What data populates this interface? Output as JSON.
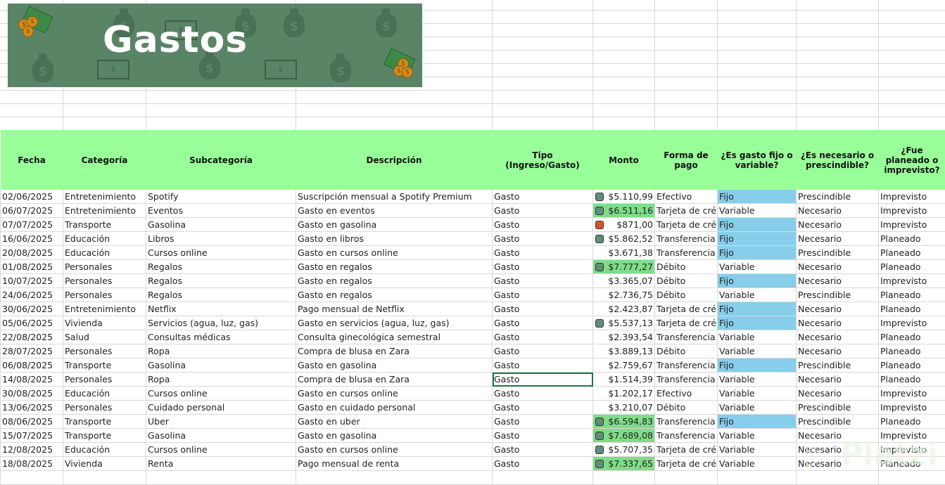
{
  "banner": {
    "title": "Gastos"
  },
  "colors": {
    "header_bg": "#99ff99",
    "highlight_green": "#7fdd88",
    "fijo_blue": "#87ceeb",
    "indicator_gray": "#5f8f7a",
    "indicator_red": "#d9532c",
    "banner_bg": "#5a8466"
  },
  "headers": [
    "Fecha",
    "Categoría",
    "Subcategoría",
    "Descripción",
    "Tipo (Ingreso/Gasto)",
    "Monto",
    "Forma de pago",
    "¿Es gasto fijo o variable?",
    "¿Es necesario o prescindible?",
    "¿Fue planeado o imprevisto?"
  ],
  "rows": [
    {
      "fecha": "02/06/2025",
      "cat": "Entretenimiento",
      "sub": "Spotify",
      "desc": "Suscripción mensual a Spotify Premium",
      "tipo": "Gasto",
      "monto": "$5.110,99",
      "icon": "gray",
      "hi": false,
      "pago": "Efectivo",
      "fv": "Fijo",
      "np": "Prescindible",
      "pi": "Imprevisto"
    },
    {
      "fecha": "06/07/2025",
      "cat": "Entretenimiento",
      "sub": "Eventos",
      "desc": "Gasto en eventos",
      "tipo": "Gasto",
      "monto": "$6.511,16",
      "icon": "gray",
      "hi": true,
      "pago": "Tarjeta de cré",
      "fv": "Variable",
      "np": "Necesario",
      "pi": "Imprevisto"
    },
    {
      "fecha": "07/07/2025",
      "cat": "Transporte",
      "sub": "Gasolina",
      "desc": "Gasto en gasolina",
      "tipo": "Gasto",
      "monto": "$871,00",
      "icon": "red",
      "hi": false,
      "pago": "Tarjeta de cré",
      "fv": "Fijo",
      "np": "Necesario",
      "pi": "Imprevisto"
    },
    {
      "fecha": "16/06/2025",
      "cat": "Educación",
      "sub": "Libros",
      "desc": "Gasto en libros",
      "tipo": "Gasto",
      "monto": "$5.862,52",
      "icon": "gray",
      "hi": false,
      "pago": "Transferencia",
      "fv": "Fijo",
      "np": "Necesario",
      "pi": "Planeado"
    },
    {
      "fecha": "20/08/2025",
      "cat": "Educación",
      "sub": "Cursos online",
      "desc": "Gasto en cursos online",
      "tipo": "Gasto",
      "monto": "$3.671,38",
      "icon": "",
      "hi": false,
      "pago": "Transferencia",
      "fv": "Fijo",
      "np": "Prescindible",
      "pi": "Planeado"
    },
    {
      "fecha": "01/08/2025",
      "cat": "Personales",
      "sub": "Regalos",
      "desc": "Gasto en regalos",
      "tipo": "Gasto",
      "monto": "$7.777,27",
      "icon": "gray",
      "hi": true,
      "pago": "Débito",
      "fv": "Variable",
      "np": "Necesario",
      "pi": "Planeado"
    },
    {
      "fecha": "10/07/2025",
      "cat": "Personales",
      "sub": "Regalos",
      "desc": "Gasto en regalos",
      "tipo": "Gasto",
      "monto": "$3.365,07",
      "icon": "",
      "hi": false,
      "pago": "Débito",
      "fv": "Fijo",
      "np": "Necesario",
      "pi": "Imprevisto"
    },
    {
      "fecha": "24/06/2025",
      "cat": "Personales",
      "sub": "Regalos",
      "desc": "Gasto en regalos",
      "tipo": "Gasto",
      "monto": "$2.736,75",
      "icon": "",
      "hi": false,
      "pago": "Débito",
      "fv": "Variable",
      "np": "Prescindible",
      "pi": "Planeado"
    },
    {
      "fecha": "30/06/2025",
      "cat": "Entretenimiento",
      "sub": "Netflix",
      "desc": "Pago mensual de Netflix",
      "tipo": "Gasto",
      "monto": "$2.423,87",
      "icon": "",
      "hi": false,
      "pago": "Tarjeta de cré",
      "fv": "Fijo",
      "np": "Necesario",
      "pi": "Planeado"
    },
    {
      "fecha": "05/06/2025",
      "cat": "Vivienda",
      "sub": "Servicios (agua, luz, gas)",
      "desc": "Gasto en servicios (agua, luz, gas)",
      "tipo": "Gasto",
      "monto": "$5.537,13",
      "icon": "gray",
      "hi": false,
      "pago": "Tarjeta de cré",
      "fv": "Fijo",
      "np": "Necesario",
      "pi": "Imprevisto"
    },
    {
      "fecha": "22/08/2025",
      "cat": "Salud",
      "sub": "Consultas médicas",
      "desc": "Consulta ginecológica semestral",
      "tipo": "Gasto",
      "monto": "$2.393,54",
      "icon": "",
      "hi": false,
      "pago": "Transferencia",
      "fv": "Variable",
      "np": "Necesario",
      "pi": "Planeado"
    },
    {
      "fecha": "28/07/2025",
      "cat": "Personales",
      "sub": "Ropa",
      "desc": "Compra de blusa en Zara",
      "tipo": "Gasto",
      "monto": "$3.889,13",
      "icon": "",
      "hi": false,
      "pago": "Débito",
      "fv": "Variable",
      "np": "Necesario",
      "pi": "Planeado"
    },
    {
      "fecha": "06/08/2025",
      "cat": "Transporte",
      "sub": "Gasolina",
      "desc": "Gasto en gasolina",
      "tipo": "Gasto",
      "monto": "$2.759,67",
      "icon": "",
      "hi": false,
      "pago": "Transferencia",
      "fv": "Fijo",
      "np": "Prescindible",
      "pi": "Planeado"
    },
    {
      "fecha": "14/08/2025",
      "cat": "Personales",
      "sub": "Ropa",
      "desc": "Compra de blusa en Zara",
      "tipo": "Gasto",
      "monto": "$1.514,39",
      "icon": "",
      "hi": false,
      "pago": "Transferencia",
      "fv": "Variable",
      "np": "Necesario",
      "pi": "Planeado"
    },
    {
      "fecha": "30/08/2025",
      "cat": "Educación",
      "sub": "Cursos online",
      "desc": "Gasto en cursos online",
      "tipo": "Gasto",
      "monto": "$1.202,17",
      "icon": "",
      "hi": false,
      "pago": "Efectivo",
      "fv": "Variable",
      "np": "Necesario",
      "pi": "Imprevisto"
    },
    {
      "fecha": "13/06/2025",
      "cat": "Personales",
      "sub": "Cuidado personal",
      "desc": "Gasto en cuidado personal",
      "tipo": "Gasto",
      "monto": "$3.210,07",
      "icon": "",
      "hi": false,
      "pago": "Débito",
      "fv": "Variable",
      "np": "Prescindible",
      "pi": "Imprevisto"
    },
    {
      "fecha": "08/06/2025",
      "cat": "Transporte",
      "sub": "Uber",
      "desc": "Gasto en uber",
      "tipo": "Gasto",
      "monto": "$6.594,83",
      "icon": "gray",
      "hi": true,
      "pago": "Transferencia",
      "fv": "Fijo",
      "np": "Prescindible",
      "pi": "Planeado"
    },
    {
      "fecha": "15/07/2025",
      "cat": "Transporte",
      "sub": "Gasolina",
      "desc": "Gasto en gasolina",
      "tipo": "Gasto",
      "monto": "$7.689,08",
      "icon": "gray",
      "hi": true,
      "pago": "Transferencia",
      "fv": "Variable",
      "np": "Necesario",
      "pi": "Imprevisto"
    },
    {
      "fecha": "12/08/2025",
      "cat": "Educación",
      "sub": "Cursos online",
      "desc": "Gasto en cursos online",
      "tipo": "Gasto",
      "monto": "$5.707,35",
      "icon": "gray",
      "hi": false,
      "pago": "Tarjeta de cré",
      "fv": "Variable",
      "np": "Necesario",
      "pi": "Imprevisto"
    },
    {
      "fecha": "18/08/2025",
      "cat": "Vivienda",
      "sub": "Renta",
      "desc": "Pago mensual de renta",
      "tipo": "Gasto",
      "monto": "$7.337,65",
      "icon": "gray",
      "hi": true,
      "pago": "Tarjeta de cré",
      "fv": "Variable",
      "np": "Necesario",
      "pi": "Planeado"
    }
  ],
  "selected_row": 13,
  "watermark": "Platzi"
}
